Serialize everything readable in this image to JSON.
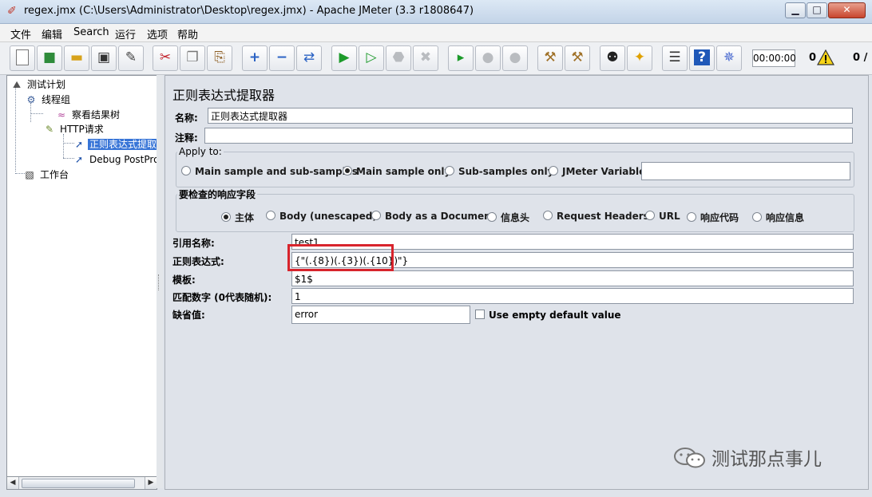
{
  "window": {
    "title": "regex.jmx (C:\\Users\\Administrator\\Desktop\\regex.jmx) - Apache JMeter (3.3 r1808647)",
    "controls": {
      "minimize": "▁",
      "maximize": "□",
      "close": "✕"
    }
  },
  "menu": [
    "文件",
    "编辑",
    "Search",
    "运行",
    "选项",
    "帮助"
  ],
  "toolbar": {
    "timer": "00:00:00",
    "warnings": "0",
    "threads": "0 /"
  },
  "tree": {
    "items": [
      {
        "label": "测试计划",
        "icon": "test-plan-icon"
      },
      {
        "label": "线程组",
        "icon": "thread-group-icon"
      },
      {
        "label": "察看结果树",
        "icon": "results-tree-icon"
      },
      {
        "label": "HTTP请求",
        "icon": "http-request-icon"
      },
      {
        "label": "正则表达式提取",
        "icon": "post-processor-icon"
      },
      {
        "label": "Debug PostPro",
        "icon": "post-processor-icon"
      },
      {
        "label": "工作台",
        "icon": "workbench-icon"
      }
    ]
  },
  "form": {
    "heading": "正则表达式提取器",
    "name_label": "名称:",
    "name_value": "正则表达式提取器",
    "comment_label": "注释:",
    "comment_value": "",
    "apply_to": {
      "title": "Apply to:",
      "options": [
        "Main sample and sub-samples",
        "Main sample only",
        "Sub-samples only",
        "JMeter Variable"
      ],
      "selected": "Main sample only",
      "variable_value": ""
    },
    "response_field": {
      "title": "要检查的响应字段",
      "options": [
        "主体",
        "Body (unescaped)",
        "Body as a Document",
        "信息头",
        "Request Headers",
        "URL",
        "响应代码",
        "响应信息"
      ],
      "selected": "主体"
    },
    "ref_name_label": "引用名称:",
    "ref_name_value": "test1",
    "regex_label": "正则表达式:",
    "regex_value": "{\"(.{8})(.{3})(.{10})\"}",
    "template_label": "模板:",
    "template_value": "$1$",
    "match_no_label": "匹配数字 (0代表随机):",
    "match_no_value": "1",
    "default_label": "缺省值:",
    "default_value": "error",
    "use_empty_default": "Use empty default value"
  },
  "watermark": "测试那点事儿",
  "colors": {
    "highlight": "#d8242c",
    "selection": "#3875d7"
  }
}
